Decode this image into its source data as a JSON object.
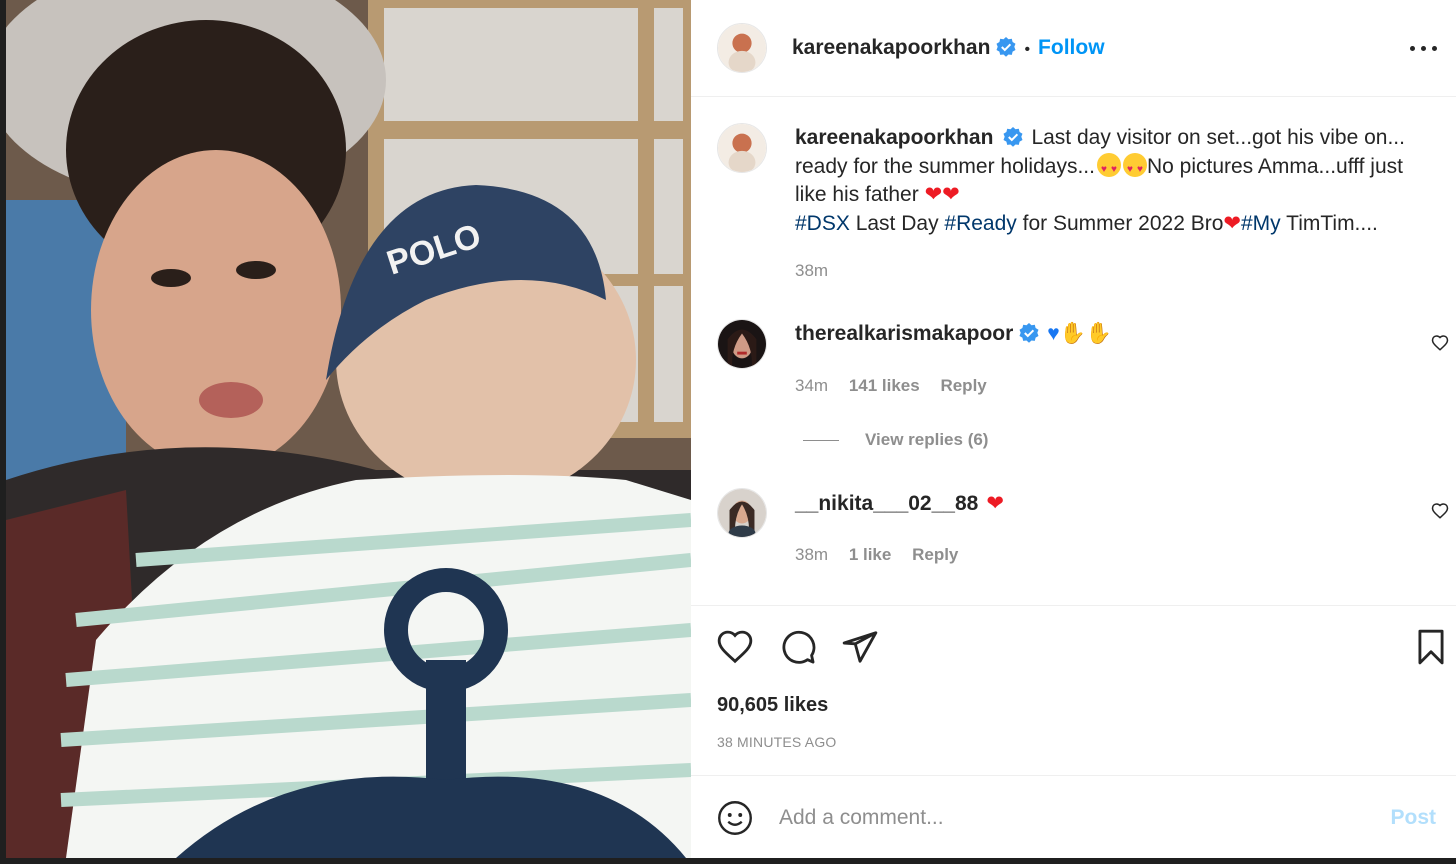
{
  "post": {
    "author": "kareenakapoorkhan",
    "follow_label": "Follow",
    "separator": "•",
    "caption": {
      "line1": "Last day visitor on set...got his vibe on... ready for the summer holidays...",
      "line2": "No pictures Amma...ufff just like his father ",
      "hashtag1": "#DSX",
      "text1": " Last Day ",
      "hashtag2": "#Ready",
      "text2": " for Summer 2022 Bro",
      "hashtag3": "#My",
      "text3": " TimTim...."
    },
    "caption_time": "38m",
    "like_count": "90,605 likes",
    "time_ago": "38 MINUTES AGO"
  },
  "comments": [
    {
      "username": "therealkarismakapoor",
      "time": "34m",
      "likes": "141 likes",
      "reply_label": "Reply",
      "view_replies": "View replies (6)"
    },
    {
      "username": "__nikita___02__88",
      "time": "38m",
      "likes": "1 like",
      "reply_label": "Reply"
    }
  ],
  "comment_box": {
    "placeholder": "Add a comment...",
    "post_label": "Post"
  },
  "icons": {
    "verified": "verified-badge-icon",
    "more": "more-options-icon",
    "like": "heart-icon",
    "comment": "comment-bubble-icon",
    "share": "paper-plane-icon",
    "save": "bookmark-icon",
    "emoji": "smiley-icon"
  },
  "colors": {
    "accent": "#0095f6",
    "hashtag": "#00376b",
    "muted": "#8e8e8e",
    "heart": "#ed1b24",
    "verified": "#3897f0"
  }
}
